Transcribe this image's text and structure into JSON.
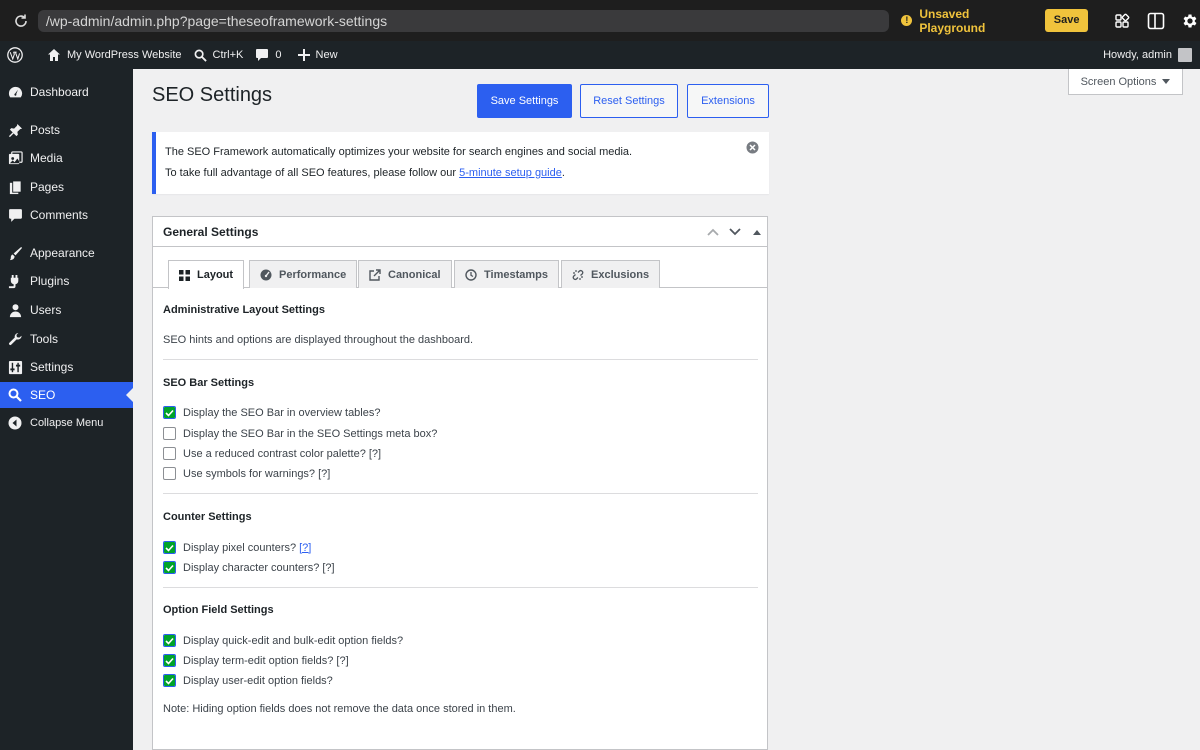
{
  "playground": {
    "url": "/wp-admin/admin.php?page=theseoframework-settings",
    "unsaved_label": "Unsaved Playground",
    "save_label": "Save"
  },
  "adminbar": {
    "site_name": "My WordPress Website",
    "shortcut": "Ctrl+K",
    "comments_count": "0",
    "new_label": "New",
    "howdy": "Howdy, admin"
  },
  "menu": {
    "items": [
      {
        "label": "Dashboard",
        "icon": "dashboard-icon"
      },
      {
        "label": "Posts",
        "icon": "pin-icon"
      },
      {
        "label": "Media",
        "icon": "media-icon"
      },
      {
        "label": "Pages",
        "icon": "pages-icon"
      },
      {
        "label": "Comments",
        "icon": "comment-icon"
      },
      {
        "label": "Appearance",
        "icon": "brush-icon"
      },
      {
        "label": "Plugins",
        "icon": "plug-icon"
      },
      {
        "label": "Users",
        "icon": "user-icon"
      },
      {
        "label": "Tools",
        "icon": "wrench-icon"
      },
      {
        "label": "Settings",
        "icon": "sliders-icon"
      },
      {
        "label": "SEO",
        "icon": "search-icon",
        "current": true
      },
      {
        "label": "Collapse Menu",
        "icon": "collapse-icon"
      }
    ]
  },
  "screen_options": "Screen Options",
  "page": {
    "title": "SEO Settings",
    "save_settings": "Save Settings",
    "reset_settings": "Reset Settings",
    "extensions": "Extensions"
  },
  "notice": {
    "line1": "The SEO Framework automatically optimizes your website for search engines and social media.",
    "line2_prefix": "To take full advantage of all SEO features, please follow our ",
    "line2_link": "5-minute setup guide",
    "line2_suffix": "."
  },
  "general": {
    "title": "General Settings",
    "tabs": [
      {
        "label": "Layout",
        "active": true
      },
      {
        "label": "Performance"
      },
      {
        "label": "Canonical"
      },
      {
        "label": "Timestamps"
      },
      {
        "label": "Exclusions"
      }
    ],
    "admin_layout_title": "Administrative Layout Settings",
    "admin_layout_desc": "SEO hints and options are displayed throughout the dashboard.",
    "seo_bar_title": "SEO Bar Settings",
    "seo_bar": [
      {
        "label": "Display the SEO Bar in overview tables?",
        "checked": true,
        "help": ""
      },
      {
        "label": "Display the SEO Bar in the SEO Settings meta box?",
        "checked": false,
        "help": ""
      },
      {
        "label": "Use a reduced contrast color palette?",
        "checked": false,
        "help": "[?]"
      },
      {
        "label": "Use symbols for warnings?",
        "checked": false,
        "help": "[?]"
      }
    ],
    "counter_title": "Counter Settings",
    "counter": [
      {
        "label": "Display pixel counters?",
        "checked": true,
        "help": "[?]",
        "help_link": true
      },
      {
        "label": "Display character counters?",
        "checked": true,
        "help": "[?]"
      }
    ],
    "option_field_title": "Option Field Settings",
    "option_field": [
      {
        "label": "Display quick-edit and bulk-edit option fields?",
        "checked": true,
        "help": ""
      },
      {
        "label": "Display term-edit option fields?",
        "checked": true,
        "help": "[?]"
      },
      {
        "label": "Display user-edit option fields?",
        "checked": true,
        "help": ""
      }
    ],
    "note": "Note: Hiding option fields does not remove the data once stored in them."
  },
  "colors": {
    "accent": "#2c5ff0",
    "adminbar": "#1d2327",
    "check": "#00a32a",
    "warning": "#f0c33c"
  }
}
